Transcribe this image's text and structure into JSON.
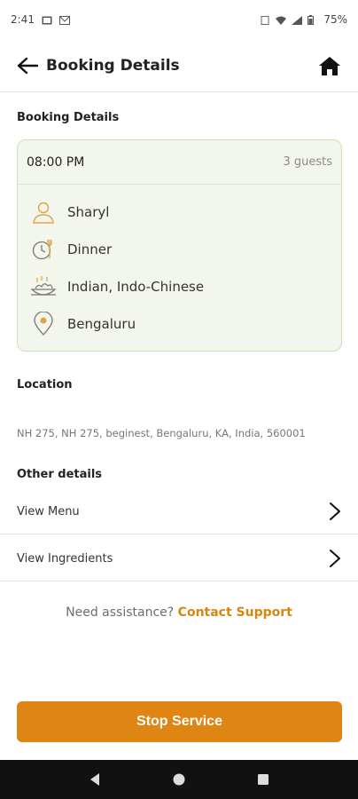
{
  "status_bar": {
    "time": "2:41",
    "battery": "75%",
    "icons": [
      "gallery-icon",
      "gmail-icon",
      "no-sim-icon",
      "wifi-icon",
      "signal-icon",
      "battery-icon"
    ]
  },
  "header": {
    "title": "Booking Details"
  },
  "booking": {
    "section_title": "Booking Details",
    "time": "08:00 PM",
    "guests": "3 guests",
    "rows": [
      {
        "icon": "person-icon",
        "label": "Sharyl"
      },
      {
        "icon": "meal-time-icon",
        "label": "Dinner"
      },
      {
        "icon": "cuisine-icon",
        "label": "Indian, Indo-Chinese"
      },
      {
        "icon": "location-pin-icon",
        "label": "Bengaluru"
      }
    ]
  },
  "location": {
    "section_title": "Location",
    "address": "NH 275, NH 275, beginest, Bengaluru, KA, India, 560001"
  },
  "other": {
    "section_title": "Other details",
    "items": [
      {
        "label": "View Menu"
      },
      {
        "label": "View Ingredients"
      }
    ]
  },
  "assistance": {
    "prompt": "Need assistance?",
    "link": "Contact Support"
  },
  "cta": {
    "label": "Stop Service"
  },
  "colors": {
    "accent": "#DF8514",
    "card_bg": "#F3F6EC",
    "card_border": "#CFE0B4"
  }
}
